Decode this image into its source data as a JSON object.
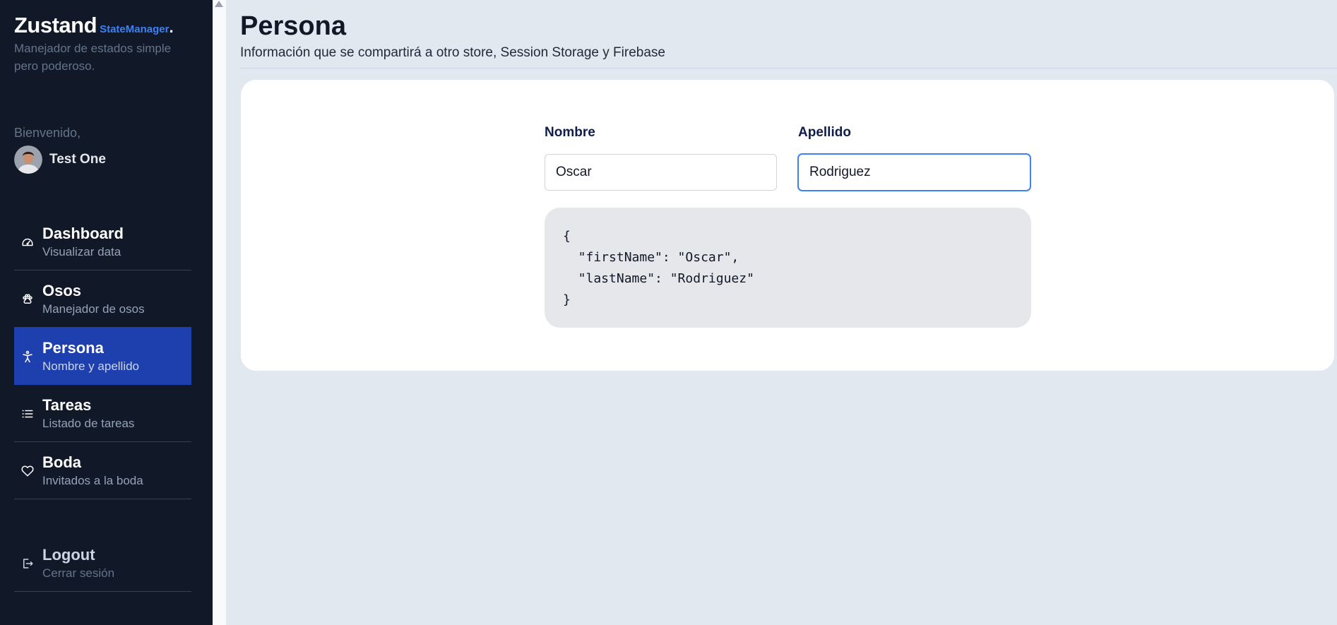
{
  "sidebar": {
    "brand_title": "Zustand",
    "brand_sub": "StateManager",
    "brand_dot": ".",
    "brand_desc": "Manejador de estados simple pero poderoso.",
    "welcome": "Bienvenido,",
    "user_name": "Test One",
    "items": [
      {
        "title": "Dashboard",
        "desc": "Visualizar data",
        "icon": "dashboard-gauge-icon",
        "active": false
      },
      {
        "title": "Osos",
        "desc": "Manejador de osos",
        "icon": "paw-icon",
        "active": false
      },
      {
        "title": "Persona",
        "desc": "Nombre y apellido",
        "icon": "person-icon",
        "active": true
      },
      {
        "title": "Tareas",
        "desc": "Listado de tareas",
        "icon": "list-icon",
        "active": false
      },
      {
        "title": "Boda",
        "desc": "Invitados a la boda",
        "icon": "heart-icon",
        "active": false
      }
    ],
    "logout": {
      "title": "Logout",
      "desc": "Cerrar sesión",
      "icon": "logout-icon"
    }
  },
  "main": {
    "title": "Persona",
    "subtitle": "Información que se compartirá a otro store, Session Storage y Firebase",
    "form": {
      "first_label": "Nombre",
      "first_value": "Oscar",
      "last_label": "Apellido",
      "last_value": "Rodriguez"
    },
    "json_output": "{\n  \"firstName\": \"Oscar\",\n  \"lastName\": \"Rodriguez\"\n}"
  },
  "colors": {
    "sidebar_bg": "#111827",
    "active_bg": "#1e40af",
    "accent": "#3b82f6",
    "page_bg": "#e2e8f0"
  }
}
